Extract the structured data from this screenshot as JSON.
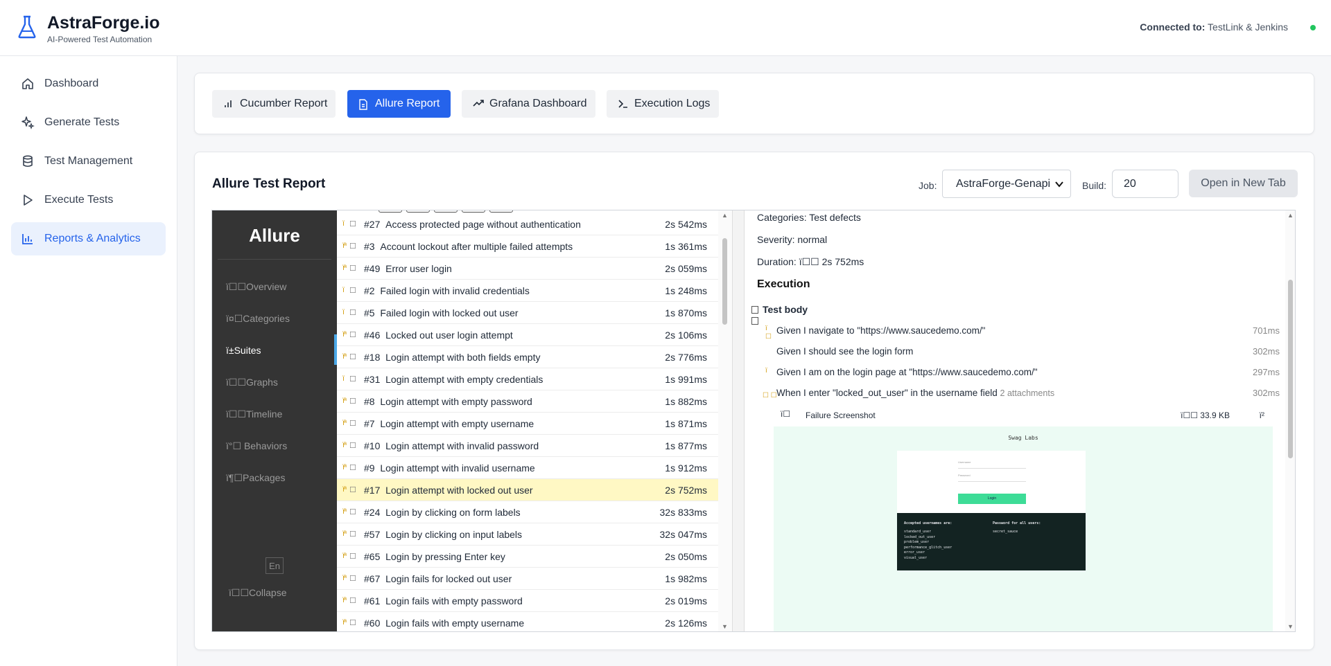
{
  "header": {
    "brand": "AstraForge.io",
    "tagline": "AI-Powered Test Automation",
    "connected_label": "Connected to:",
    "connected_value": "TestLink & Jenkins",
    "status_color": "#22c55e"
  },
  "sidebar": {
    "items": [
      {
        "label": "Dashboard",
        "icon": "home-icon"
      },
      {
        "label": "Generate Tests",
        "icon": "sparkles-icon"
      },
      {
        "label": "Test Management",
        "icon": "database-icon"
      },
      {
        "label": "Execute Tests",
        "icon": "play-icon"
      },
      {
        "label": "Reports & Analytics",
        "icon": "bar-chart-icon",
        "active": true
      }
    ]
  },
  "report_tabs": [
    {
      "label": "Cucumber Report",
      "icon": "bar-chart-icon"
    },
    {
      "label": "Allure Report",
      "icon": "file-icon",
      "active": true
    },
    {
      "label": "Grafana Dashboard",
      "icon": "trending-up-icon"
    },
    {
      "label": "Execution Logs",
      "icon": "terminal-icon"
    }
  ],
  "report": {
    "title": "Allure Test Report",
    "job_label": "Job:",
    "job_value": "AstraForge-Genapi",
    "build_label": "Build:",
    "build_value": "20",
    "open_button": "Open in New Tab"
  },
  "allure": {
    "brand": "Allure",
    "nav": [
      {
        "glyph": "ï",
        "label": "Overview"
      },
      {
        "glyph": "ï¤",
        "label": "Categories"
      },
      {
        "glyph": "ï±",
        "label": "Suites",
        "active": true
      },
      {
        "glyph": "ï",
        "label": "Graphs"
      },
      {
        "glyph": "ï",
        "label": "Timeline"
      },
      {
        "glyph": "ï°",
        "label": "Behaviors"
      },
      {
        "glyph": "ï¶",
        "label": "Packages"
      }
    ],
    "lang": "En",
    "collapse": {
      "glyph": "ï",
      "label": "Collapse"
    },
    "tests": [
      {
        "id": "#27",
        "name": "Access protected page without authentication",
        "duration": "2s 542ms",
        "status": "ï"
      },
      {
        "id": "#3",
        "name": "Account lockout after multiple failed attempts",
        "duration": "1s 361ms",
        "status": "ïª"
      },
      {
        "id": "#49",
        "name": "Error user login",
        "duration": "2s 059ms",
        "status": "ïª"
      },
      {
        "id": "#2",
        "name": "Failed login with invalid credentials",
        "duration": "1s 248ms",
        "status": "ï"
      },
      {
        "id": "#5",
        "name": "Failed login with locked out user",
        "duration": "1s 870ms",
        "status": "ï"
      },
      {
        "id": "#46",
        "name": "Locked out user login attempt",
        "duration": "2s 106ms",
        "status": "ïª"
      },
      {
        "id": "#18",
        "name": "Login attempt with both fields empty",
        "duration": "2s 776ms",
        "status": "ïª"
      },
      {
        "id": "#31",
        "name": "Login attempt with empty credentials",
        "duration": "1s 991ms",
        "status": "ï"
      },
      {
        "id": "#8",
        "name": "Login attempt with empty password",
        "duration": "1s 882ms",
        "status": "ïª"
      },
      {
        "id": "#7",
        "name": "Login attempt with empty username",
        "duration": "1s 871ms",
        "status": "ïª"
      },
      {
        "id": "#10",
        "name": "Login attempt with invalid password",
        "duration": "1s 877ms",
        "status": "ïª"
      },
      {
        "id": "#9",
        "name": "Login attempt with invalid username",
        "duration": "1s 912ms",
        "status": "ïª"
      },
      {
        "id": "#17",
        "name": "Login attempt with locked out user",
        "duration": "2s 752ms",
        "status": "ïª",
        "selected": true
      },
      {
        "id": "#24",
        "name": "Login by clicking on form labels",
        "duration": "32s 833ms",
        "status": "ïª"
      },
      {
        "id": "#57",
        "name": "Login by clicking on input labels",
        "duration": "32s 047ms",
        "status": "ïª"
      },
      {
        "id": "#65",
        "name": "Login by pressing Enter key",
        "duration": "2s 050ms",
        "status": "ïª"
      },
      {
        "id": "#67",
        "name": "Login fails for locked out user",
        "duration": "1s 982ms",
        "status": "ïª"
      },
      {
        "id": "#61",
        "name": "Login fails with empty password",
        "duration": "2s 019ms",
        "status": "ïª"
      },
      {
        "id": "#60",
        "name": "Login fails with empty username",
        "duration": "2s 126ms",
        "status": "ïª"
      }
    ],
    "detail": {
      "categories": "Categories: Test defects",
      "severity": "Severity: normal",
      "duration_label": "Duration:",
      "duration_glyph": "ï",
      "duration_value": "2s 752ms",
      "execution_heading": "Execution",
      "test_body": "Test body",
      "steps": [
        {
          "glyph": "ï",
          "text": "Given I navigate to \"https://www.saucedemo.com/\"",
          "duration": "701ms"
        },
        {
          "glyph": "",
          "text": "Given I should see the login form",
          "duration": "302ms"
        },
        {
          "glyph": "ï",
          "text": "Given I am on the login page at \"https://www.saucedemo.com/\"",
          "duration": "297ms"
        },
        {
          "glyph": "",
          "text": "When I enter \"locked_out_user\" in the username field",
          "extra": "2 attachments",
          "duration": "302ms"
        }
      ],
      "attachment": {
        "glyph": "ï",
        "name": "Failure Screenshot",
        "size_glyph": "ï",
        "size": "33.9 KB",
        "action_glyph": "ï²"
      },
      "screenshot": {
        "title": "Swag Labs",
        "username_placeholder": "Username",
        "password_placeholder": "Password",
        "login": "Login",
        "accepted_heading": "Accepted usernames are:",
        "usernames": "standard_user\nlocked_out_user\nproblem_user\nperformance_glitch_user\nerror_user\nvisual_user",
        "password_heading": "Password for all users:",
        "password_value": "secret_sauce"
      }
    }
  }
}
